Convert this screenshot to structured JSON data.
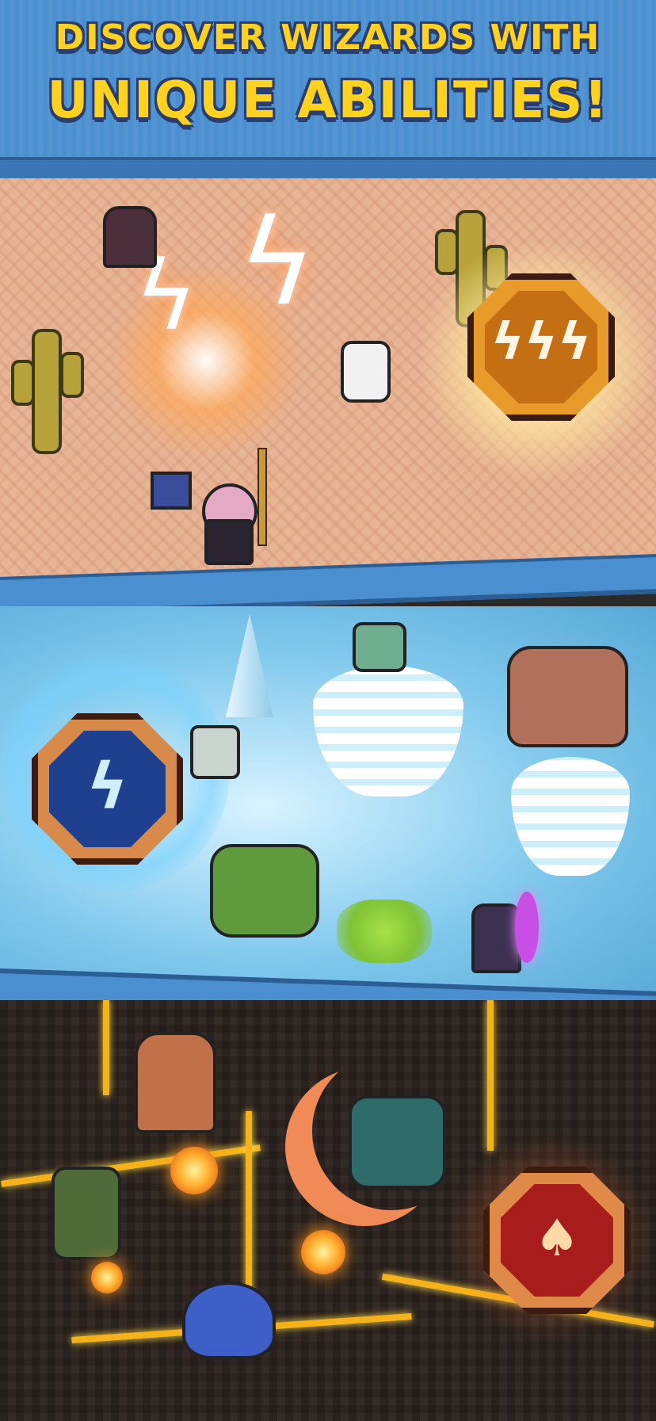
{
  "header": {
    "line1": "DISCOVER WIZARDS WITH",
    "line2": "UNIQUE ABILITIES!"
  },
  "scenes": {
    "desert": {
      "ability": "lightning",
      "medal_icon": "lightning-bolts-icon"
    },
    "ice": {
      "ability": "frost-tornado",
      "medal_icon": "ice-bolt-icon"
    },
    "lava": {
      "ability": "fire",
      "medal_icon": "flame-icon"
    }
  },
  "colors": {
    "title_yellow": "#ffd21f",
    "title_outline": "#2a3d6b",
    "header_blue": "#4a8fd0",
    "desert_sand": "#e7b495",
    "ice_blue": "#9fd8f2",
    "lava_rock": "#2e241f",
    "lava_glow": "#f5b21a"
  }
}
